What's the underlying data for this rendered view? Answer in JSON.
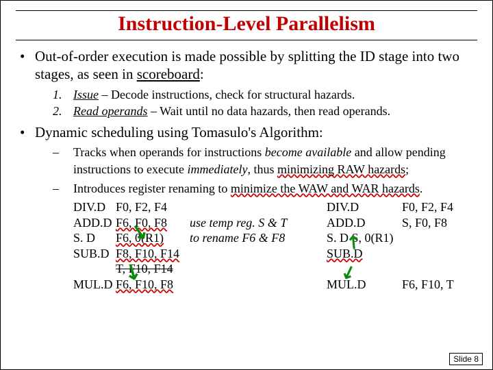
{
  "title": "Instruction-Level Parallelism",
  "p1a": "Out-of-order execution is made possible by splitting the ID stage into two stages, as seen in ",
  "p1b": "scoreboard",
  "p1c": ":",
  "step1_n": "1.",
  "step1_a": "Issue",
  "step1_b": " – Decode instructions, check for structural hazards.",
  "step2_n": "2.",
  "step2_a": "Read operands",
  "step2_b": " – Wait until no data hazards, then read operands.",
  "p2": "Dynamic scheduling using Tomasulo's Algorithm:",
  "d1a": "Tracks when operands for instructions ",
  "d1b": "become available",
  "d1c": " and allow pending instructions to execute ",
  "d1d": "immediately",
  "d1e": ", thus ",
  "d1f": "minimizing RAW hazards",
  "d1g": ";",
  "d2a": "Introduces register renaming to ",
  "d2b": "minimize the WAW and WAR hazards",
  "d2c": ".",
  "code": {
    "left": {
      "l1_op": "DIV.D",
      "l1_ar": "F0, F2, F4",
      "l2_op": "ADD.D",
      "l2_ar": "F6, F0, F8",
      "l3_op": "S. D",
      "l3_ar": "F6, 0(R1)",
      "l4_op": "SUB.D",
      "l4_ar": "F8, F10, F14",
      "l5_ar": "T, F10, F14",
      "l6_op": "MUL.D",
      "l6_ar": "F6, F10, F8"
    },
    "mid": {
      "m1": "use temp reg. S & T",
      "m2": "to rename F6 & F8"
    },
    "right": {
      "r1_op": "DIV.D",
      "r1_ar": "F0, F2, F4",
      "r2_op": "ADD.D",
      "r2_ar": "S, F0, F8",
      "r3_op": "S. D S, 0(R1)",
      "r3_ar": "",
      "r4_op": "SUB.D",
      "r4_ar": "",
      "r6_op": "MUL.D",
      "r6_ar": "F6, F10, T"
    }
  },
  "slide_tag": "Slide 8"
}
